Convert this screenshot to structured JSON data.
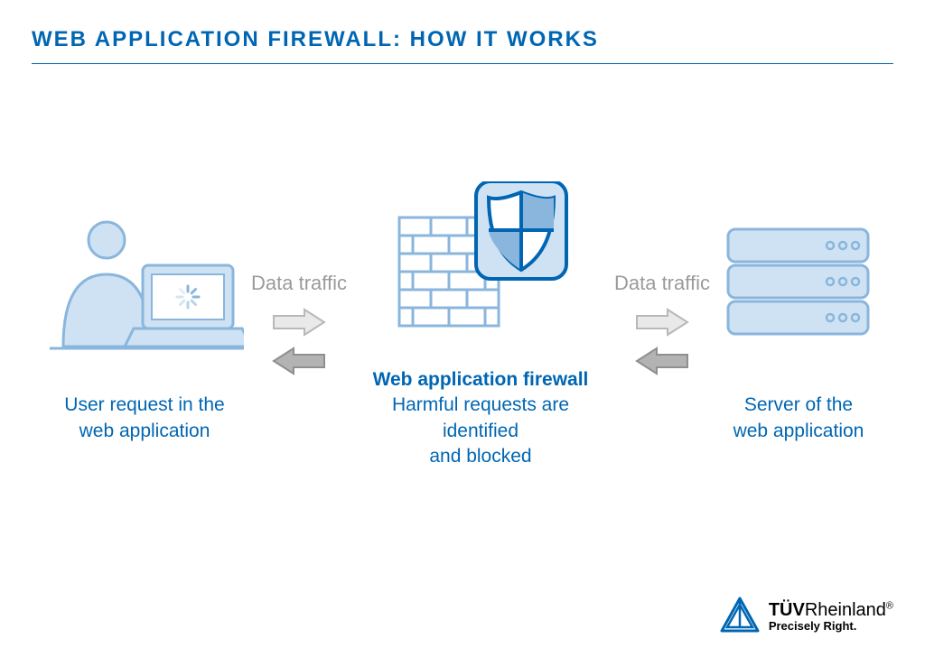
{
  "title": "WEB APPLICATION FIREWALL: HOW IT WORKS",
  "traffic_label_left": "Data traffic",
  "traffic_label_right": "Data traffic",
  "user": {
    "line1": "User request in the",
    "line2": "web application"
  },
  "waf": {
    "heading": "Web application firewall",
    "line1": "Harmful requests are identified",
    "line2": "and blocked"
  },
  "server": {
    "line1": "Server of the",
    "line2": "web application"
  },
  "brand": {
    "name_bold": "TÜV",
    "name_rest": "Rheinland",
    "reg": "®",
    "tagline": "Precisely Right."
  },
  "colors": {
    "brand_blue": "#0066b3",
    "light_blue_fill": "#cfe2f3",
    "mid_blue": "#8ab6dd",
    "grey": "#9A9A9A"
  }
}
